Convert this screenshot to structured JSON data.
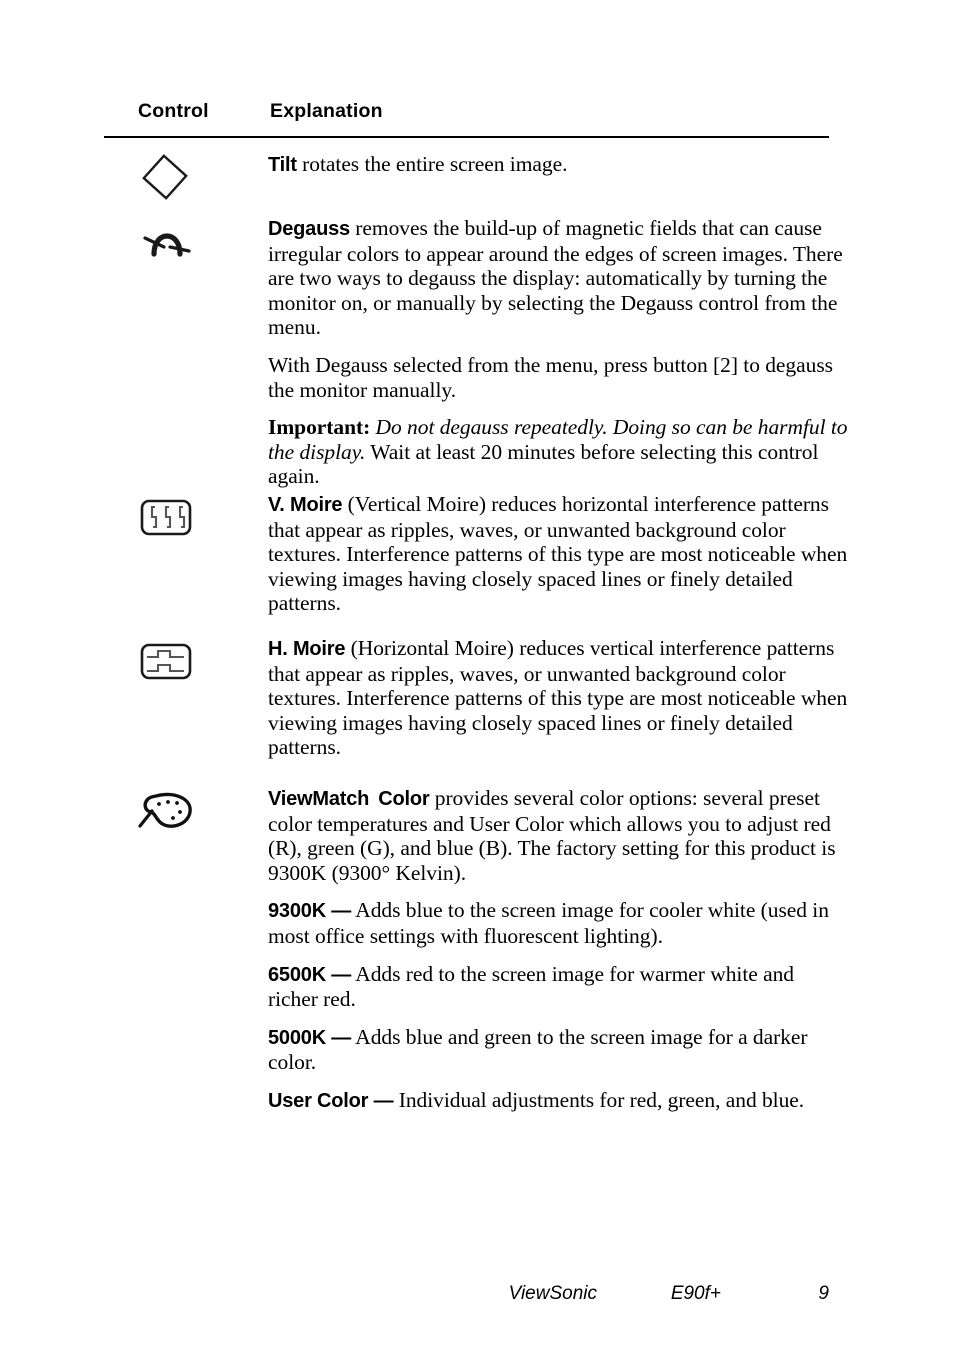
{
  "page": {
    "footer": {
      "brand": "ViewSonic",
      "model": "E90f+",
      "page_number": "9"
    }
  },
  "table": {
    "headers": {
      "control": "Control",
      "explanation": "Explanation"
    },
    "rows": [
      {
        "icon": "diamond-tilt-icon",
        "term": "Tilt",
        "paragraphs": [
          {
            "lead": "Tilt",
            "text": " rotates the entire screen image."
          }
        ]
      },
      {
        "icon": "degauss-magnet-icon",
        "term": "Degauss",
        "paragraphs": [
          {
            "lead": "Degauss",
            "text": " removes the build-up of magnetic fields that can cause irregular colors to appear around the edges of screen images. There are two ways to degauss the display: automatically by turning the monitor on, or manually by selecting the Degauss control from the menu."
          },
          {
            "lead": "",
            "text": "With Degauss selected from the menu, press button [2] to degauss the monitor manually."
          },
          {
            "lead": "Important:",
            "italic": " Do not degauss repeatedly. Doing so can be harmful to the display.",
            "text": " Wait at least 20 minutes before selecting this control again."
          }
        ]
      },
      {
        "icon": "vertical-moire-icon",
        "term": "V. Moire",
        "paragraphs": [
          {
            "lead": "V. Moire",
            "text": " (Vertical Moire) reduces horizontal interference patterns that appear as ripples, waves, or unwanted background color textures. Interference patterns of this type are most noticeable when viewing images having closely spaced lines or finely detailed patterns."
          }
        ]
      },
      {
        "icon": "horizontal-moire-icon",
        "term": "H. Moire",
        "paragraphs": [
          {
            "lead": "H. Moire",
            "text": " (Horizontal Moire) reduces vertical interference patterns that appear as ripples, waves, or unwanted background color textures. Interference patterns of this type are most noticeable when viewing images having closely spaced lines or finely detailed patterns."
          }
        ]
      },
      {
        "icon": "viewmatch-palette-icon",
        "term": "ViewMatch Color",
        "paragraphs": [
          {
            "lead": "ViewMatch",
            "lead2": "Color",
            "text": " provides several color options: several preset color temperatures and User Color which allows you to adjust red (R), green (G), and blue (B). The factory setting for this product is 9300K (9300° Kelvin)."
          },
          {
            "lead": "9300K —",
            "text": " Adds blue to the screen image for cooler white (used in most office settings with fluorescent lighting)."
          },
          {
            "lead": "6500K —",
            "text": " Adds red to the screen image for warmer white and richer red."
          },
          {
            "lead": "5000K —",
            "text": " Adds blue and green to the screen image for a darker color."
          },
          {
            "lead": "User Color —",
            "text": " Individual adjustments for red, green, and blue."
          }
        ]
      }
    ]
  }
}
